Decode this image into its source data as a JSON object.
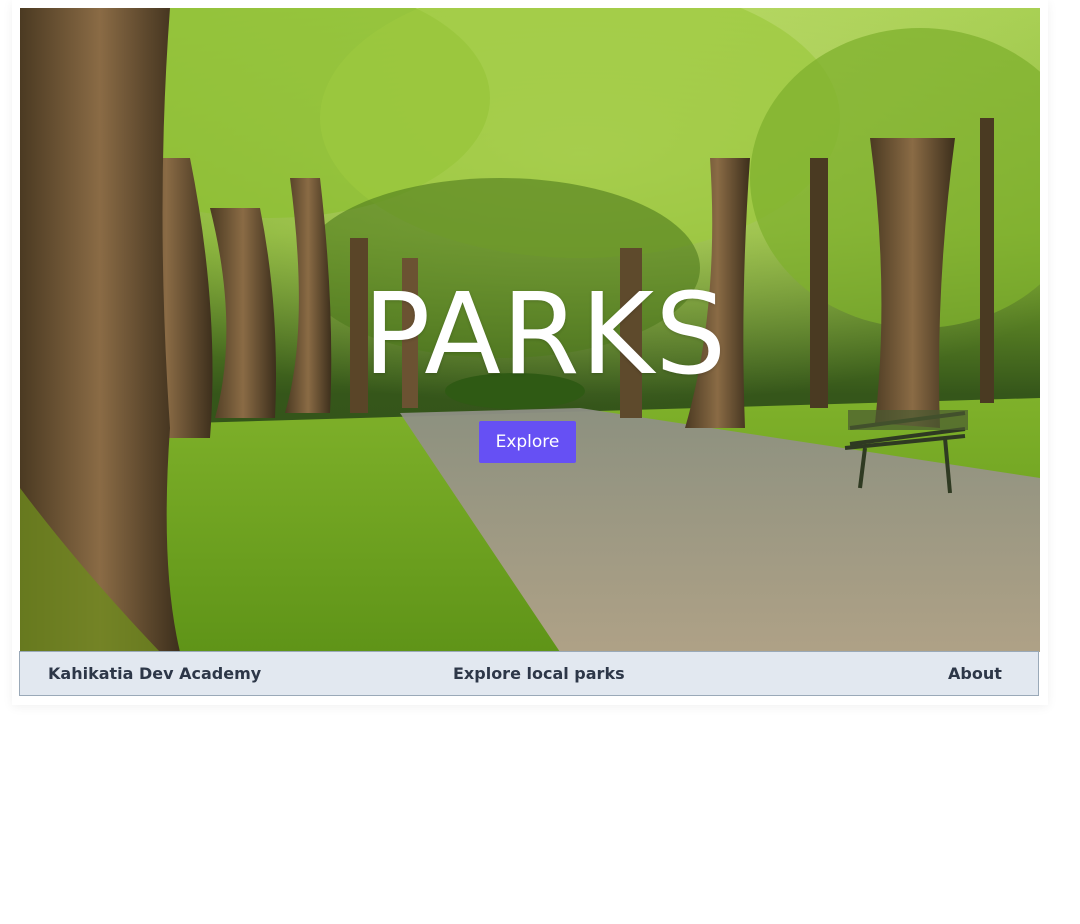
{
  "hero": {
    "title": "PARKS",
    "button_label": "Explore",
    "image_subject": "tree-lined park path with bench"
  },
  "navbar": {
    "brand": "Kahikatia Dev Academy",
    "explore_link": "Explore local parks",
    "about_link": "About"
  },
  "colors": {
    "button": "#6650f4",
    "navbar_bg": "#e2e8f0",
    "navbar_text": "#2d3748",
    "hero_text": "#ffffff"
  }
}
